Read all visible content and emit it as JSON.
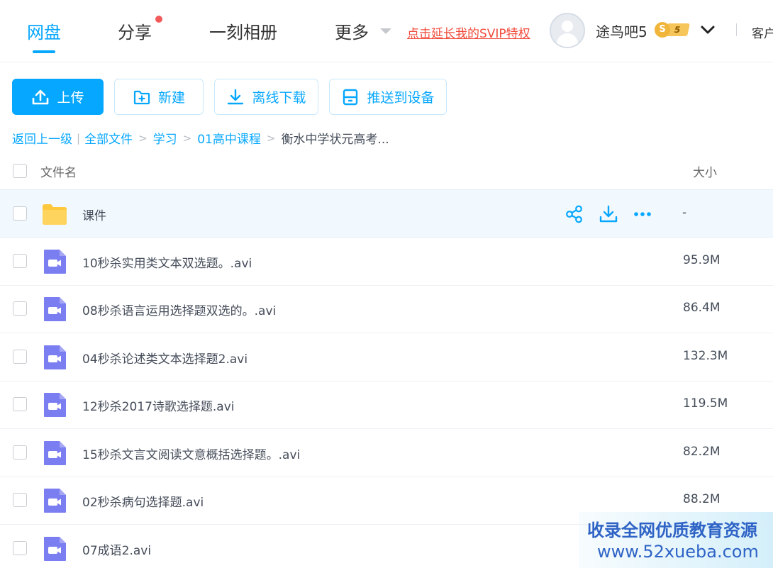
{
  "nav": {
    "tabs": [
      {
        "label": "网盘",
        "active": true
      },
      {
        "label": "分享",
        "has_dot": true
      },
      {
        "label": "一刻相册"
      },
      {
        "label": "更多"
      }
    ],
    "svip_link": "点击延长我的SVIP特权",
    "username": "途鸟吧5",
    "vip_coin": "S",
    "vip_level": "5",
    "client_label": "客户"
  },
  "toolbar": {
    "upload": "上传",
    "new": "新建",
    "offline_download": "离线下载",
    "push_device": "推送到设备"
  },
  "breadcrumb": {
    "back": "返回上一级",
    "items": [
      "全部文件",
      "学习",
      "01高中课程"
    ],
    "current": "衡水中学状元高考..."
  },
  "table": {
    "header_name": "文件名",
    "header_size": "大小",
    "rows": [
      {
        "name": "课件",
        "size": "-",
        "type": "folder"
      },
      {
        "name": "10秒杀实用类文本双选题。.avi",
        "size": "95.9M",
        "type": "video"
      },
      {
        "name": "08秒杀语言运用选择题双选的。.avi",
        "size": "86.4M",
        "type": "video"
      },
      {
        "name": "04秒杀论述类文本选择题2.avi",
        "size": "132.3M",
        "type": "video"
      },
      {
        "name": "12秒杀2017诗歌选择题.avi",
        "size": "119.5M",
        "type": "video"
      },
      {
        "name": "15秒杀文言文阅读文意概括选择题。.avi",
        "size": "82.2M",
        "type": "video"
      },
      {
        "name": "02秒杀病句选择题.avi",
        "size": "88.2M",
        "type": "video"
      },
      {
        "name": "07成语2.avi",
        "size": "",
        "type": "video"
      }
    ]
  },
  "watermark": {
    "line1": "收录全网优质教育资源",
    "line2": "www.52xueba.com"
  },
  "colors": {
    "accent": "#06a7ff",
    "svip_red": "#f04c3c",
    "folder_yellow": "#ffc83d",
    "video_purple": "#7b7ef0"
  }
}
